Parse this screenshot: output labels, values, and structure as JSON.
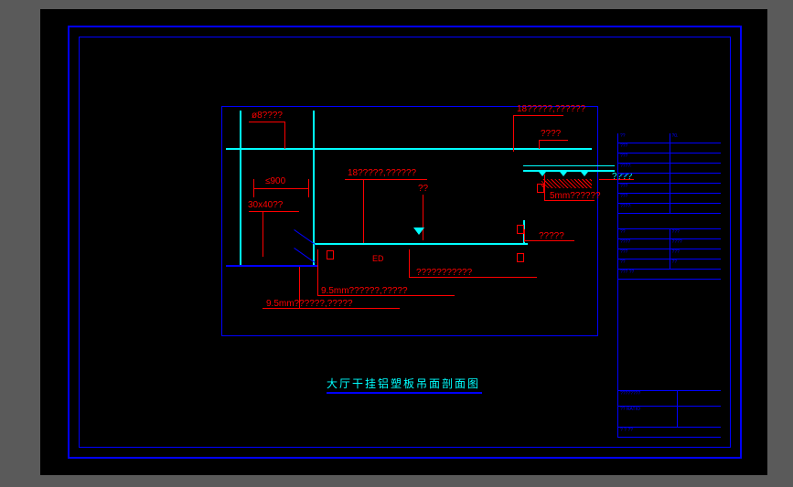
{
  "title": "大厅干挂铝塑板吊面剖面图",
  "annotations": {
    "diam8": "ø8????",
    "le900": "≤900",
    "size30x40": "30x40??",
    "label18a": "18?????,??????",
    "label18b": "18?????,??????",
    "light": "??",
    "label5mm": "5mm??????",
    "question": "????",
    "label_right": "?????",
    "question_row": "???????????",
    "label95a": "9.5mm??????,?????",
    "label95b": "9.5mm??????,?????",
    "ed": "ED"
  },
  "title_block": {
    "rows_top": [
      {
        "l": "??",
        "r": "?0."
      },
      {
        "l": "???",
        "r": ""
      },
      {
        "l": "???",
        "r": ""
      },
      {
        "l": "????:",
        "r": ""
      },
      {
        "l": "???",
        "r": ""
      },
      {
        "l": "???",
        "r": ""
      },
      {
        "l": "???",
        "r": ""
      },
      {
        "l": "????:",
        "r": ""
      }
    ],
    "rows_mid": [
      {
        "l": "??",
        "r": "???"
      },
      {
        "l": "????",
        "r": "????"
      },
      {
        "l": "???",
        "r": "???"
      },
      {
        "l": "??",
        "r": "??"
      }
    ],
    "small_header": "??? ??",
    "id_label": "????????",
    "id": "SE06",
    "ratio_label": "?? RATIO",
    "page": "25",
    "footer": "? ? ??"
  }
}
